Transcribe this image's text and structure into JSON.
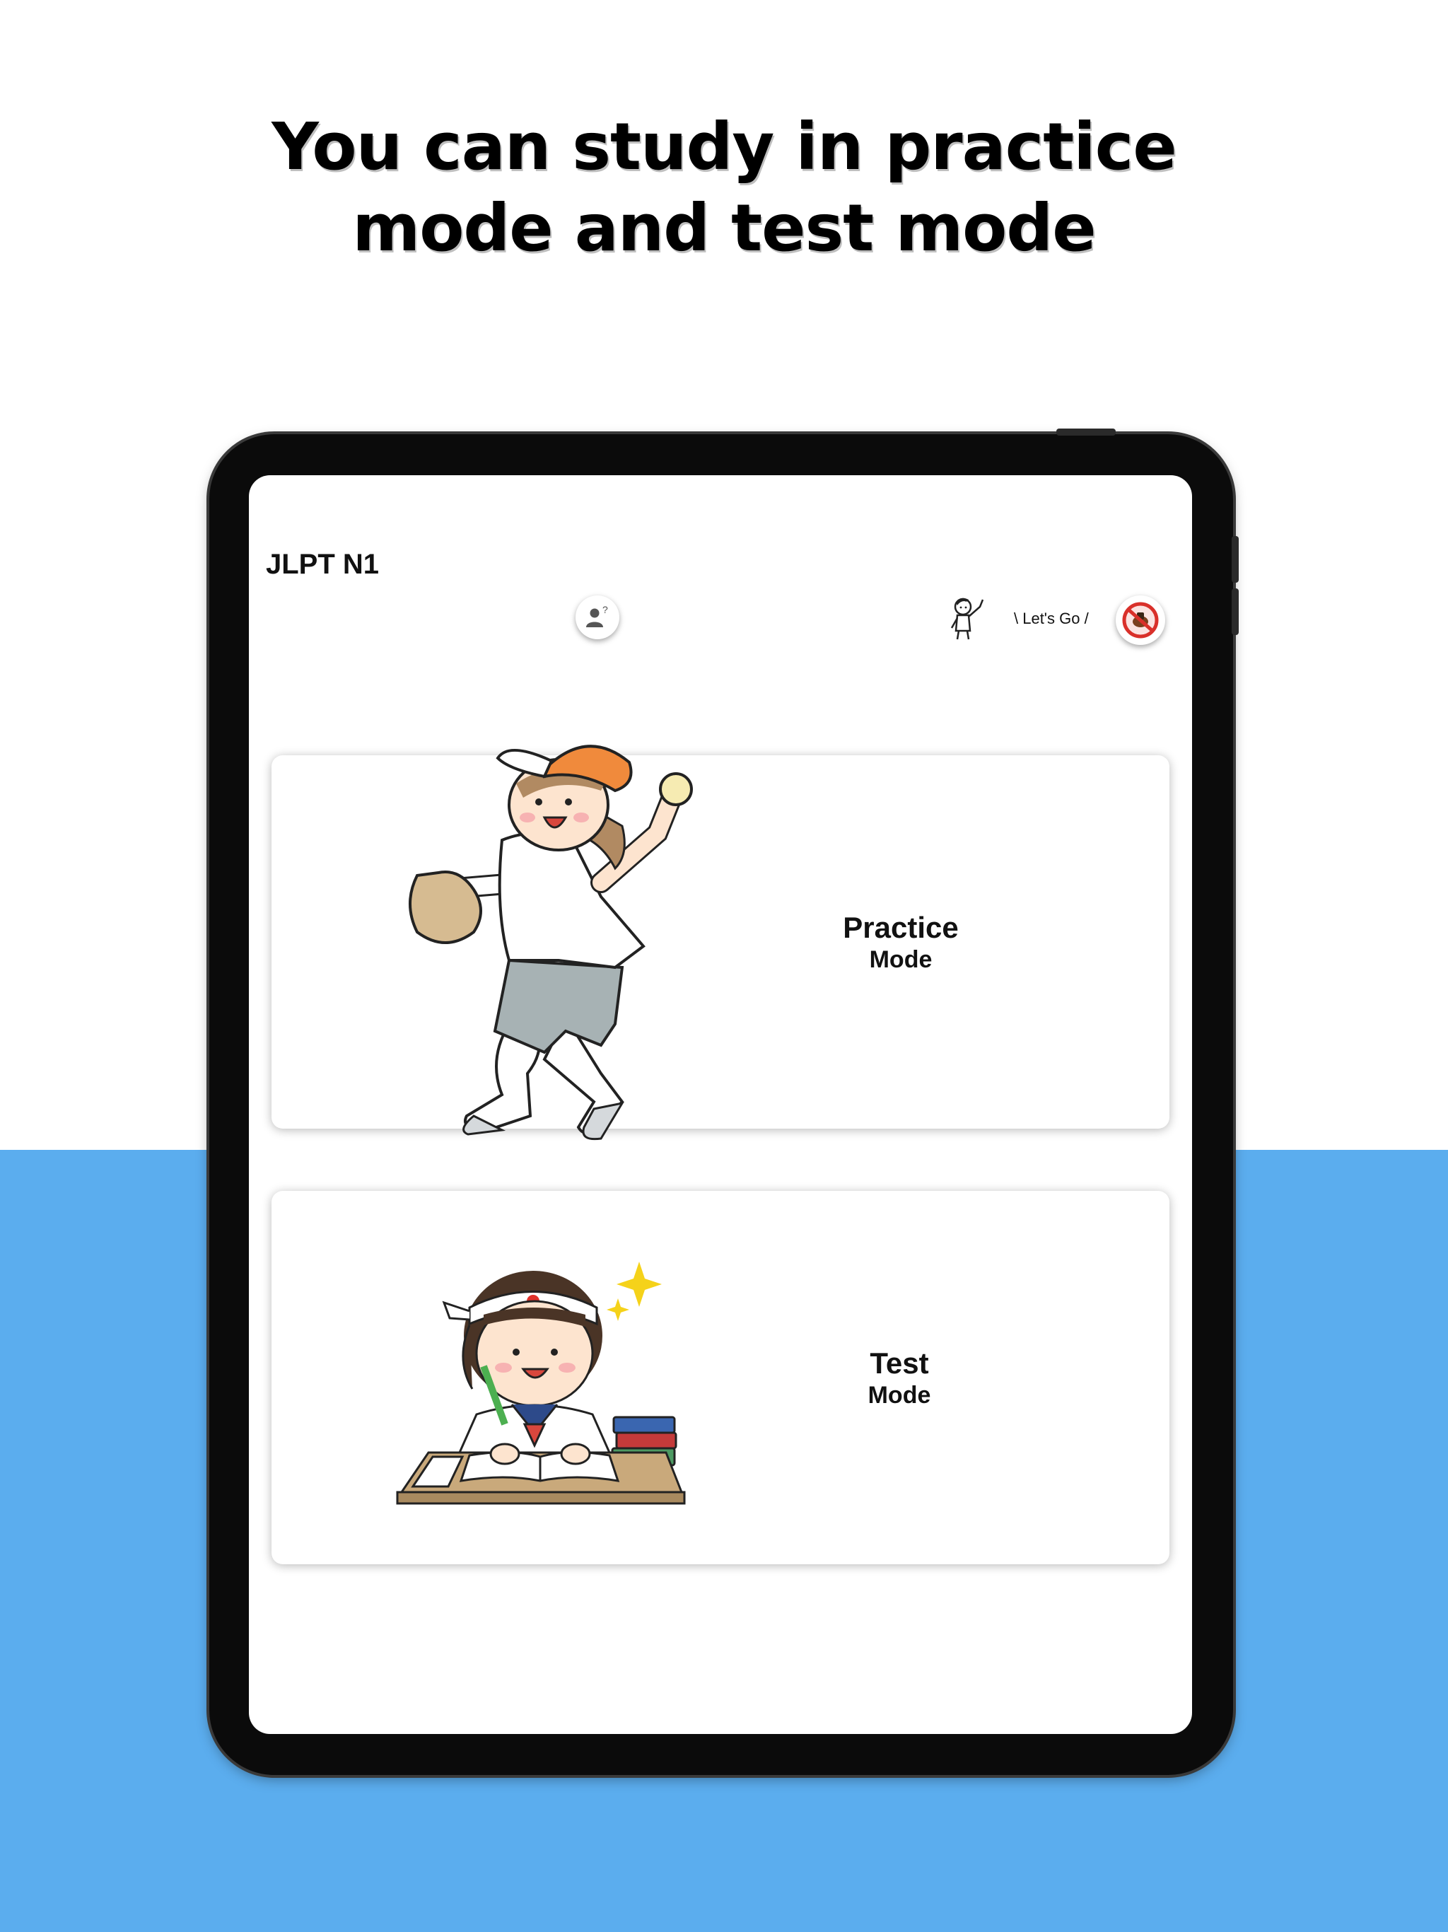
{
  "headline": {
    "line1": "You can study in practice",
    "line2": "mode and test mode"
  },
  "app": {
    "title": "JLPT N1",
    "toolbar": {
      "profile_help_icon": "person-question-icon",
      "lets_go_text": "\\ Let's Go /",
      "no_ads_icon": "no-ads-icon"
    }
  },
  "modes": [
    {
      "title": "Practice",
      "subtitle": "Mode",
      "illustration": "pitcher-illustration"
    },
    {
      "title": "Test",
      "subtitle": "Mode",
      "illustration": "student-studying-illustration"
    }
  ],
  "colors": {
    "background_bottom": "#5badee",
    "tablet_frame": "#0b0b0b",
    "cap_orange": "#f08a3c",
    "no_sign_red": "#d9302a"
  }
}
